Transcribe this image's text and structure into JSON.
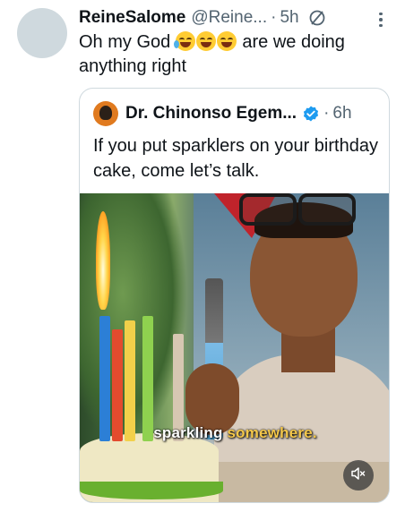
{
  "tweet": {
    "author_name": "ReineSalome",
    "author_handle": "@Reine...",
    "separator": "·",
    "time": "5h",
    "text_prefix": "Oh my God",
    "text_suffix": "are we doing anything right",
    "emojis": [
      "loudly-crying-face-emoji",
      "face-with-tears-of-joy-emoji",
      "face-with-tears-of-joy-emoji"
    ]
  },
  "quote": {
    "author_name": "Dr. Chinonso Egem...",
    "separator": "·",
    "time": "6h",
    "text": "If you put sparklers on your birthday cake, come let’s talk.",
    "video": {
      "caption_a": "sparkling",
      "caption_b": "somewhere."
    }
  },
  "colors": {
    "text": "#0f1419",
    "secondary": "#536471",
    "verified": "#1d9bf0",
    "border": "#cfd9de",
    "caption_highlight": "#f5c84a"
  }
}
